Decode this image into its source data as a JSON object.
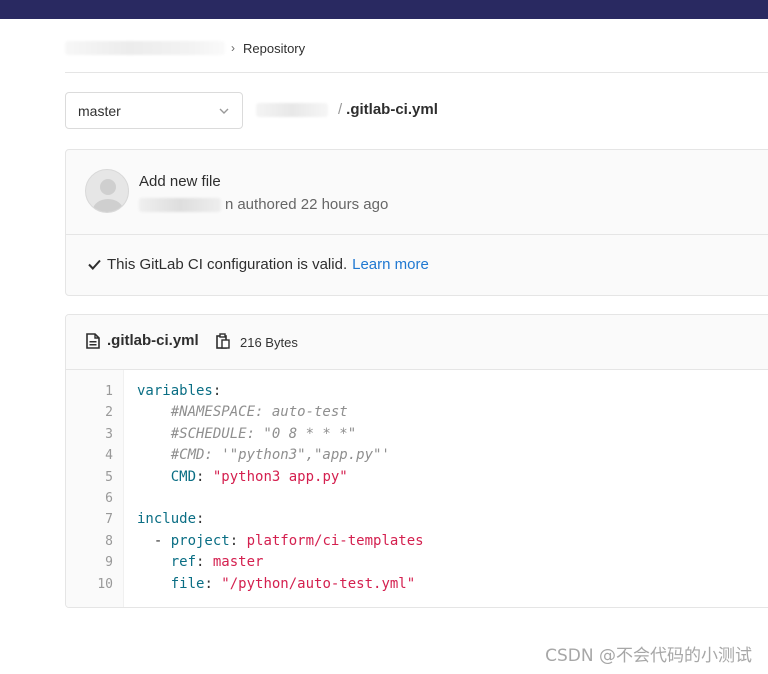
{
  "breadcrumb": {
    "current": "Repository",
    "separator": "›"
  },
  "branch": {
    "selected": "master"
  },
  "file_path": {
    "separator": "/",
    "file": ".gitlab-ci.yml"
  },
  "commit": {
    "title": "Add new file",
    "author_suffix": "n",
    "authored_text": "authored 22 hours ago"
  },
  "ci_status": {
    "message": "This GitLab CI configuration is valid.",
    "link": "Learn more"
  },
  "file": {
    "name": ".gitlab-ci.yml",
    "size": "216 Bytes",
    "lines": [
      {
        "num": "1",
        "tokens": [
          {
            "t": "k",
            "v": "variables"
          },
          {
            "t": "p",
            "v": ":"
          }
        ]
      },
      {
        "num": "2",
        "tokens": [
          {
            "t": "p",
            "v": "    "
          },
          {
            "t": "c",
            "v": "#NAMESPACE: auto-test"
          }
        ]
      },
      {
        "num": "3",
        "tokens": [
          {
            "t": "p",
            "v": "    "
          },
          {
            "t": "c",
            "v": "#SCHEDULE: \"0 8 * * *\""
          }
        ]
      },
      {
        "num": "4",
        "tokens": [
          {
            "t": "p",
            "v": "    "
          },
          {
            "t": "c",
            "v": "#CMD: '\"python3\",\"app.py\"'"
          }
        ]
      },
      {
        "num": "5",
        "tokens": [
          {
            "t": "p",
            "v": "    "
          },
          {
            "t": "k",
            "v": "CMD"
          },
          {
            "t": "p",
            "v": ": "
          },
          {
            "t": "s",
            "v": "\"python3 app.py\""
          }
        ]
      },
      {
        "num": "6",
        "tokens": []
      },
      {
        "num": "7",
        "tokens": [
          {
            "t": "k",
            "v": "include"
          },
          {
            "t": "p",
            "v": ":"
          }
        ]
      },
      {
        "num": "8",
        "tokens": [
          {
            "t": "p",
            "v": "  - "
          },
          {
            "t": "k",
            "v": "project"
          },
          {
            "t": "p",
            "v": ": "
          },
          {
            "t": "s",
            "v": "platform/ci-templates"
          }
        ]
      },
      {
        "num": "9",
        "tokens": [
          {
            "t": "p",
            "v": "    "
          },
          {
            "t": "k",
            "v": "ref"
          },
          {
            "t": "p",
            "v": ": "
          },
          {
            "t": "s",
            "v": "master"
          }
        ]
      },
      {
        "num": "10",
        "tokens": [
          {
            "t": "p",
            "v": "    "
          },
          {
            "t": "k",
            "v": "file"
          },
          {
            "t": "p",
            "v": ": "
          },
          {
            "t": "s",
            "v": "\"/python/auto-test.yml\""
          }
        ]
      }
    ]
  },
  "watermark": "CSDN @不会代码的小测试",
  "icons": {
    "branch_dropdown": "chevron-down-icon",
    "check": "check-icon",
    "file": "file-icon",
    "copy": "copy-icon",
    "avatar": "avatar"
  },
  "colors": {
    "topbar": "#292961",
    "link": "#1f78d1",
    "yaml_key": "#0a6e84",
    "yaml_string": "#d4204f",
    "yaml_comment": "#8f8f8f"
  }
}
